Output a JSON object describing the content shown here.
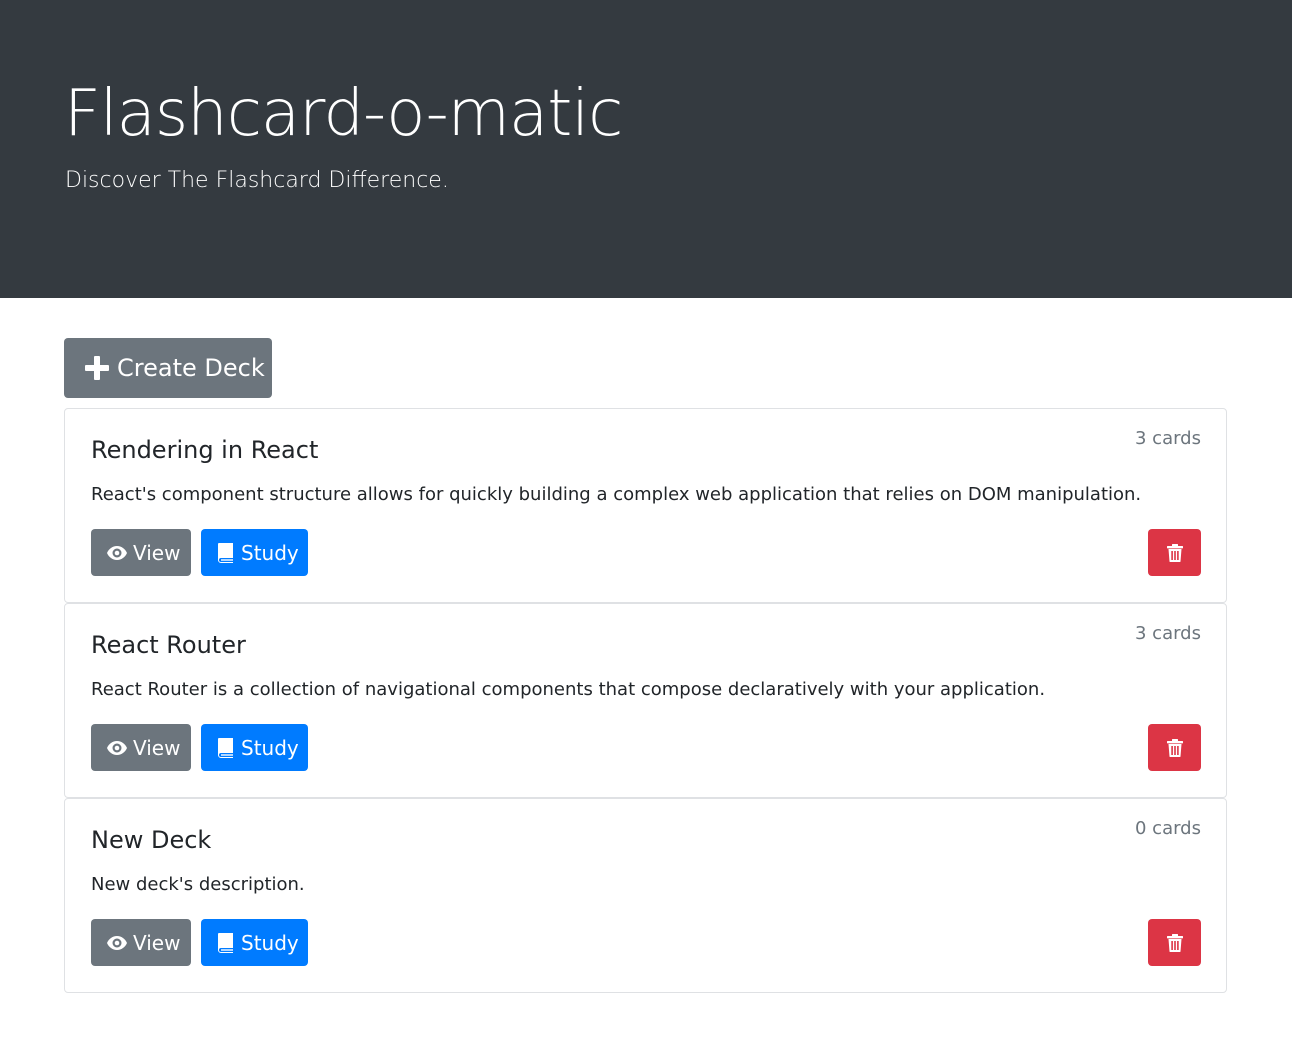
{
  "header": {
    "title": "Flashcard-o-matic",
    "subtitle": "Discover The Flashcard Difference."
  },
  "toolbar": {
    "create_label": "Create Deck"
  },
  "decks": [
    {
      "name": "Rendering in React",
      "count": "3 cards",
      "description": "React's component structure allows for quickly building a complex web application that relies on DOM manipulation.",
      "view_label": "View",
      "study_label": "Study"
    },
    {
      "name": "React Router",
      "count": "3 cards",
      "description": "React Router is a collection of navigational components that compose declaratively with your application.",
      "view_label": "View",
      "study_label": "Study"
    },
    {
      "name": "New Deck",
      "count": "0 cards",
      "description": "New deck's description.",
      "view_label": "View",
      "study_label": "Study"
    }
  ],
  "icons": {
    "create": "plus-icon",
    "view": "eye-icon",
    "study": "book-icon",
    "delete": "trash-icon"
  },
  "colors": {
    "header_bg": "#343a40",
    "secondary": "#6c757d",
    "primary": "#007bff",
    "danger": "#dc3545"
  }
}
